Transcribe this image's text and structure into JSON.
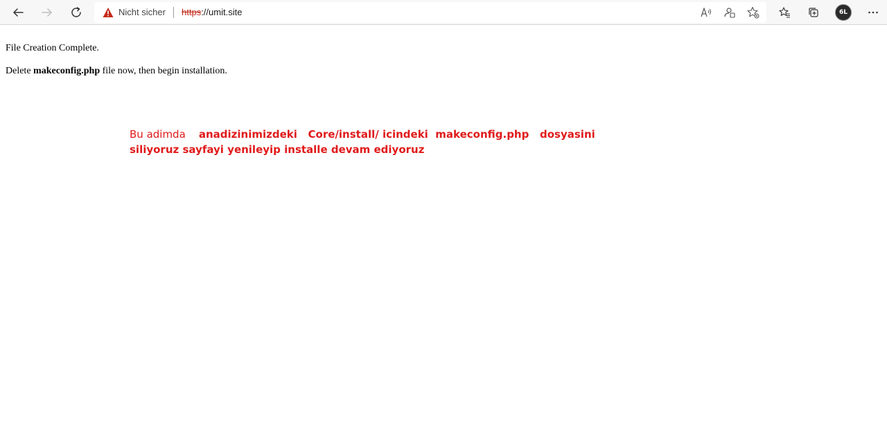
{
  "browser": {
    "security_status": "Nicht sicher",
    "url_scheme": "https",
    "url_rest": "://umit.site",
    "profile_initials": "6L",
    "icons": {
      "back": "back-arrow-icon",
      "forward": "forward-arrow-icon",
      "reload": "reload-icon",
      "warning": "warning-triangle-icon",
      "read_aloud": "read-aloud-icon",
      "tracking": "tracking-prevention-icon",
      "add_favorite": "add-favorite-icon",
      "favorites": "favorites-icon",
      "collections": "collections-icon",
      "more": "more-menu-icon"
    },
    "colors": {
      "warning": "#c42b1c"
    }
  },
  "page": {
    "line1": "File Creation Complete.",
    "line2_prefix": "Delete ",
    "line2_bold": "makeconfig.php",
    "line2_suffix": " file now, then begin installation."
  },
  "annotation": {
    "prefix": "Bu adimda",
    "bold_text": "anadizinimizdeki   Core/install/ icindeki  makeconfig.php   dosyasini siliyoruz sayfayi yenileyip installe devam ediyoruz",
    "color": "#e01b1b"
  }
}
